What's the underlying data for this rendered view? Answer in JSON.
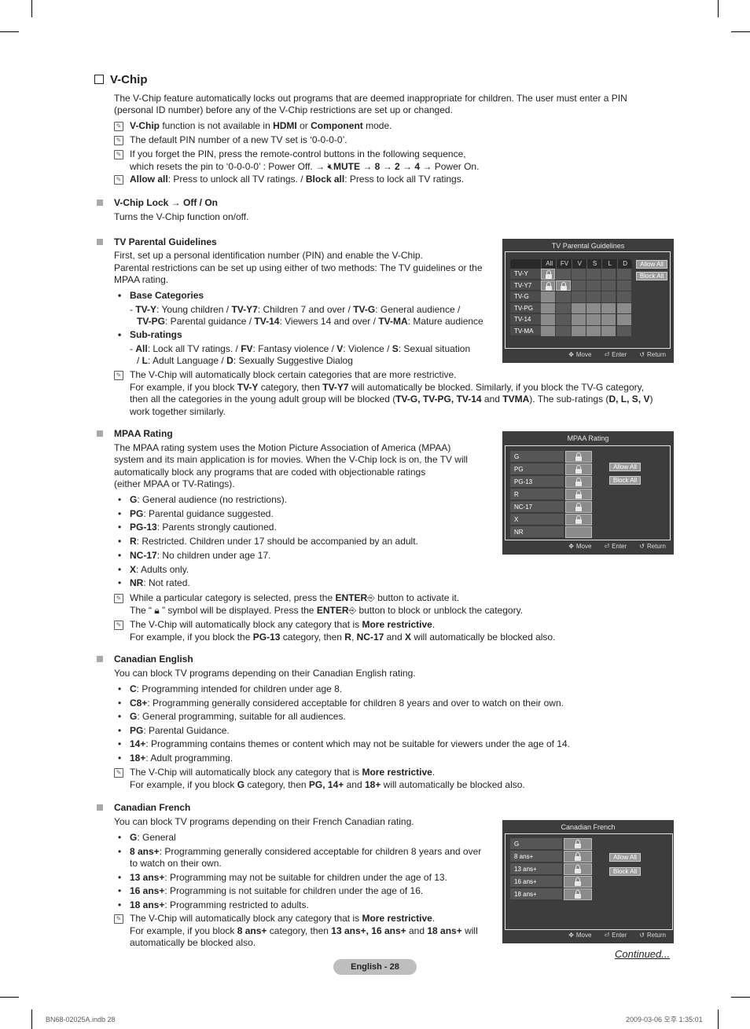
{
  "title": "V-Chip",
  "intro": "The V-Chip feature automatically locks out programs that are deemed inappropriate for children. The user must enter a PIN",
  "intro2": "(personal ID number) before any of the V-Chip restrictions are set up or changed.",
  "notes_top": [
    {
      "b1": "V-Chip",
      "t1": " function is not available in ",
      "b2": "HDMI",
      "t2": " or ",
      "b3": "Component",
      "t3": " mode."
    },
    {
      "t": "The default PIN number of a new TV set is ‘0-0-0-0’."
    },
    {
      "l1": "If you forget the PIN, press the remote-control buttons in the following sequence,",
      "l2a": "which resets the pin to ‘0-0-0-0’ : Power Off. → ",
      "mute": "MUTE",
      "l2b": " → ",
      "k8": "8",
      "k2": "2",
      "k4": "4",
      "l2c": " → Power On."
    },
    {
      "b1": "Allow all",
      "t1": ": Press to unlock all TV ratings. / ",
      "b2": "Block all",
      "t2": ": Press to lock all TV ratings."
    }
  ],
  "vchip_lock": {
    "heading_a": "V-Chip Lock",
    "heading_arrow": " → ",
    "heading_b": "Off / On",
    "desc": "Turns the V-Chip function on/off."
  },
  "tvpg": {
    "heading": "TV Parental Guidelines",
    "p1": "First, set up a personal identification number (PIN) and enable the V-Chip.",
    "p2": "Parental restrictions can be set up using either of two methods: The TV guidelines or the",
    "p3": "MPAA rating.",
    "base_title": "Base Categories",
    "sub_title": "Sub-ratings",
    "note1": "The V-Chip will automatically block certain categories that are more restrictive.",
    "note2a": "For example, if you block ",
    "note2b": "TV-Y",
    "note2c": " category, then ",
    "note2d": "TV-Y7",
    "note2e": " will automatically be blocked. Similarly, if you block the TV-G category,",
    "note3a": "then all the categories in the young adult group will be blocked (",
    "note3b": "TV-G, TV-PG, TV-14",
    "note3c": " and ",
    "note3d": "TVMA",
    "note3e": "). The sub-ratings (",
    "note3f": "D, L, S, V",
    "note3g": ")",
    "note4": "work together similarly."
  },
  "osd_tv": {
    "title": "TV Parental Guidelines",
    "columns": [
      "All",
      "FV",
      "V",
      "S",
      "L",
      "D"
    ],
    "rows": [
      "TV-Y",
      "TV-Y7",
      "TV-G",
      "TV-PG",
      "TV-14",
      "TV-MA"
    ],
    "locked": [
      [
        0,
        0
      ],
      [
        1,
        0
      ],
      [
        1,
        1
      ]
    ],
    "allow_all": "Allow All",
    "block_all": "Block All",
    "footer": {
      "move": "Move",
      "enter": "Enter",
      "return": "Return"
    }
  },
  "mpaa": {
    "heading": "MPAA Rating",
    "p1": "The MPAA rating system uses the Motion Picture Association of America (MPAA)",
    "p2": "system and its main application is for movies. When the V-Chip lock is on, the TV will",
    "p3": "automatically block any programs that are coded with objectionable ratings",
    "p4": "(either MPAA or TV-Ratings).",
    "items": [
      {
        "k": "G",
        "v": ": General audience (no restrictions)."
      },
      {
        "k": "PG",
        "v": ": Parental guidance suggested."
      },
      {
        "k": "PG-13",
        "v": ": Parents strongly cautioned."
      },
      {
        "k": "R",
        "v": ": Restricted. Children under 17 should be accompanied by an adult."
      },
      {
        "k": "NC-17",
        "v": ": No children under age 17."
      },
      {
        "k": "X",
        "v": ": Adults only."
      },
      {
        "k": "NR",
        "v": ": Not rated."
      }
    ],
    "n1a": "While a particular category is selected, press the ",
    "n1b": "ENTER",
    "n1c": " button to activate it.",
    "n2a": "The “ ",
    "n2b": " ” symbol will be displayed. Press the ",
    "n2c": "ENTER",
    "n2d": " button to block or unblock the category.",
    "n3a": "The V-Chip will automatically block any category that is ",
    "n3b": "More restrictive",
    "n3c": ".",
    "n4a": "For example, if you block the ",
    "n4b": "PG-13",
    "n4c": " category, then ",
    "n4d": "R",
    "n4e": ", ",
    "n4f": "NC-17",
    "n4g": " and ",
    "n4h": "X",
    "n4i": " will automatically be blocked also."
  },
  "osd_mpaa": {
    "title": "MPAA Rating",
    "rows": [
      "G",
      "PG",
      "PG-13",
      "R",
      "NC-17",
      "X",
      "NR"
    ],
    "locked": [
      0,
      1,
      2,
      3,
      4,
      5
    ],
    "allow_all": "Allow All",
    "block_all": "Block All",
    "footer": {
      "move": "Move",
      "enter": "Enter",
      "return": "Return"
    }
  },
  "can_en": {
    "heading": "Canadian English",
    "p1": "You can block TV programs depending on their Canadian English rating.",
    "items": [
      {
        "k": "C",
        "v": ": Programming intended for children under age 8."
      },
      {
        "k": "C8+",
        "v": ": Programming generally considered acceptable for children 8 years and over to watch on their own."
      },
      {
        "k": "G",
        "v": ": General programming, suitable for all audiences."
      },
      {
        "k": "PG",
        "v": ": Parental Guidance."
      },
      {
        "k": "14+",
        "v": ": Programming contains themes or content which may not be suitable for viewers under the age of 14."
      },
      {
        "k": "18+",
        "v": ": Adult programming."
      }
    ],
    "n1a": "The V-Chip will automatically block any category that is ",
    "n1b": "More restrictive",
    "n1c": ".",
    "n2a": "For example, if you block ",
    "n2b": "G",
    "n2c": " category, then ",
    "n2d": "PG, 14+",
    "n2e": " and ",
    "n2f": "18+",
    "n2g": " will automatically be blocked also."
  },
  "can_fr": {
    "heading": "Canadian French",
    "p1": "You can block TV programs depending on their French Canadian rating.",
    "items": [
      {
        "k": "G",
        "v": ": General"
      },
      {
        "k": "8 ans+",
        "v": ": Programming generally considered acceptable for children 8 years and over",
        "v2": "to watch on their own."
      },
      {
        "k": "13 ans+",
        "v": ": Programming may not be suitable for children under the age of 13."
      },
      {
        "k": "16 ans+",
        "v": ": Programming is not suitable for children under the age of 16."
      },
      {
        "k": "18 ans+",
        "v": ": Programming restricted to adults."
      }
    ],
    "n1a": "The V-Chip will automatically block any category that is ",
    "n1b": "More restrictive",
    "n1c": ".",
    "n2a": "For example, if you block ",
    "n2b": "8 ans+",
    "n2c": " category, then ",
    "n2d": "13 ans+, 16 ans+",
    "n2e": " and ",
    "n2f": "18 ans+",
    "n2g": " will",
    "n3": "automatically be blocked also."
  },
  "osd_fr": {
    "title": "Canadian French",
    "rows": [
      "G",
      "8 ans+",
      "13 ans+",
      "16 ans+",
      "18 ans+"
    ],
    "locked": [
      0,
      1,
      2,
      3,
      4
    ],
    "allow_all": "Allow All",
    "block_all": "Block All",
    "footer": {
      "move": "Move",
      "enter": "Enter",
      "return": "Return"
    }
  },
  "continued": "Continued...",
  "page_label": "English - 28",
  "slug_left": "BN68-02025A.indb   28",
  "slug_right": "2009-03-06   오후 1:35:01"
}
